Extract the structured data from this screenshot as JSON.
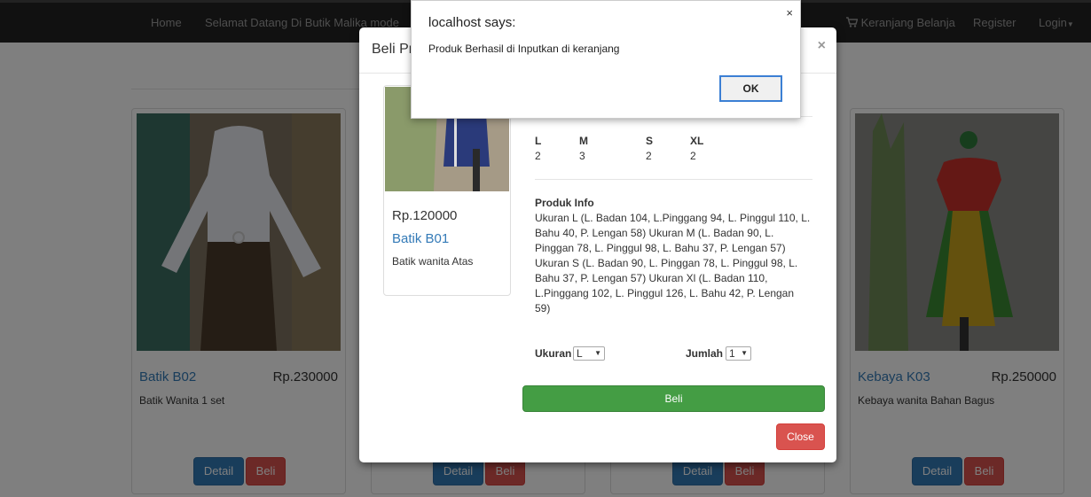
{
  "navbar": {
    "home": "Home",
    "welcome": "Selamat Datang Di Butik Malika mode",
    "cart": "Keranjang Belanja",
    "register": "Register",
    "login": "Login"
  },
  "products": [
    {
      "name": "Batik B02",
      "price": "Rp.230000",
      "desc": "Batik Wanita 1 set",
      "detail_label": "Detail",
      "beli_label": "Beli"
    },
    {
      "name": "",
      "price": "",
      "desc": "",
      "detail_label": "Detail",
      "beli_label": "Beli"
    },
    {
      "name": "",
      "price": "",
      "desc": "",
      "detail_label": "Detail",
      "beli_label": "Beli"
    },
    {
      "name": "Kebaya K03",
      "price": "Rp.250000",
      "desc": "Kebaya wanita Bahan Bagus",
      "detail_label": "Detail",
      "beli_label": "Beli"
    }
  ],
  "modal": {
    "title": "Beli Pr",
    "product": {
      "price": "Rp.120000",
      "name": "Batik B01",
      "desc": "Batik wanita Atas"
    },
    "stock_sizes": [
      "L",
      "M",
      "S",
      "XL"
    ],
    "stock_values": [
      "2",
      "3",
      "2",
      "2"
    ],
    "info_title": "Produk Info",
    "info_text": "Ukuran L (L. Badan 104, L.Pinggang 94, L. Pinggul 110, L. Bahu 40, P. Lengan 58) Ukuran M (L. Badan 90, L. Pinggan 78, L. Pinggul 98, L. Bahu 37, P. Lengan 57) Ukuran S (L. Badan 90, L. Pinggan 78, L. Pinggul 98, L. Bahu 37, P. Lengan 57) Ukuran Xl (L. Badan 110, L.Pinggang 102, L. Pinggul 126, L. Bahu 42, P. Lengan 59)",
    "size_label": "Ukuran",
    "size_value": "L",
    "qty_label": "Jumlah",
    "qty_value": "1",
    "beli_label": "Beli",
    "close_label": "Close",
    "close_x": "×"
  },
  "alert": {
    "title": "localhost says:",
    "message": "Produk Berhasil di Inputkan di keranjang",
    "ok_label": "OK",
    "close_x": "×"
  },
  "colors": {
    "navbar": "#222222",
    "link": "#337ab7",
    "danger": "#d9534f",
    "success": "#449d44"
  }
}
